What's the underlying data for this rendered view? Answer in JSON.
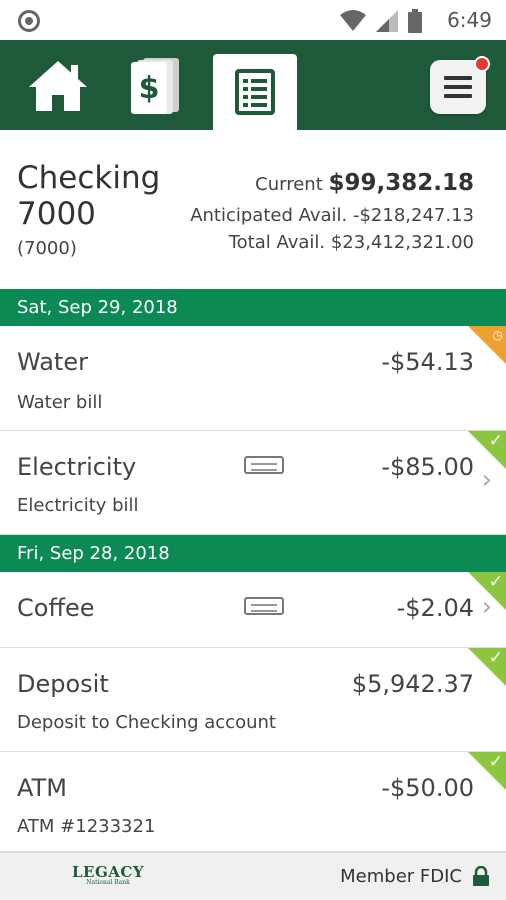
{
  "status_bar": {
    "time": "6:49"
  },
  "nav": {
    "tabs": [
      {
        "name": "home",
        "icon": "home-icon"
      },
      {
        "name": "money",
        "icon": "dollar-icon"
      },
      {
        "name": "register",
        "icon": "register-icon",
        "active": true
      }
    ],
    "menu_icon": "menu-icon",
    "menu_badge": true
  },
  "account": {
    "name": "Checking 7000",
    "number": "(7000)",
    "current_label": "Current",
    "current_value": "$99,382.18",
    "anticipated": "Anticipated Avail. -$218,247.13",
    "total": "Total Avail. $23,412,321.00"
  },
  "groups": [
    {
      "date": "Sat, Sep 29, 2018",
      "transactions": [
        {
          "title": "Water",
          "desc": "Water bill",
          "amount": "-$54.13",
          "status": "pending"
        },
        {
          "title": "Electricity",
          "desc": "Electricity bill",
          "amount": "-$85.00",
          "status": "cleared",
          "receipt": true,
          "chevron": true
        }
      ]
    },
    {
      "date": "Fri, Sep 28, 2018",
      "transactions": [
        {
          "title": "Coffee",
          "desc": "",
          "amount": "-$2.04",
          "status": "cleared",
          "receipt": true,
          "chevron": true
        },
        {
          "title": "Deposit",
          "desc": "Deposit to Checking account",
          "amount": "$5,942.37",
          "status": "cleared"
        },
        {
          "title": "ATM",
          "desc": "ATM #1233321",
          "amount": "-$50.00",
          "status": "cleared"
        }
      ]
    }
  ],
  "footer": {
    "logo": "LEGACY",
    "logo_sub": "National Bank",
    "fdic": "Member FDIC"
  },
  "colors": {
    "nav_bg": "#1e5a3a",
    "date_bar": "#0b8a54",
    "cleared": "#8cc63f",
    "pending": "#f0a030",
    "badge": "#e53935"
  }
}
